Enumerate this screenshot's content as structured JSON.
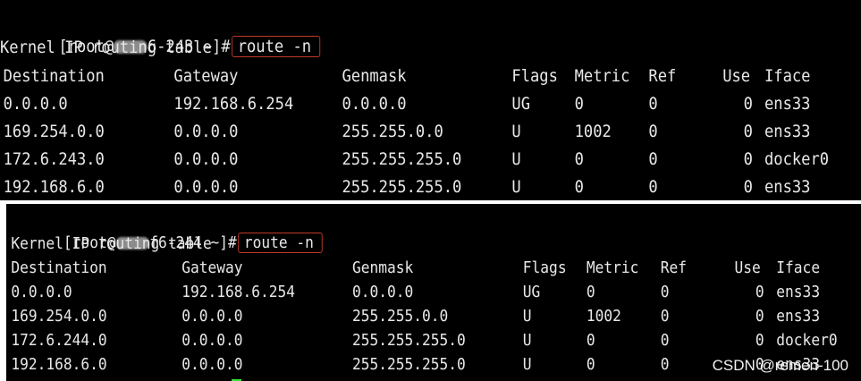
{
  "terminal_top": {
    "prompt_pre": "[root@",
    "prompt_host_visible": "6-243 ~]#",
    "command": "route -n",
    "title": "Kernel IP routing table",
    "headers": [
      "Destination",
      "Gateway",
      "Genmask",
      "Flags",
      "Metric",
      "Ref",
      "Use",
      "Iface"
    ],
    "rows": [
      [
        "0.0.0.0",
        "192.168.6.254",
        "0.0.0.0",
        "UG",
        "0",
        "0",
        "0",
        "ens33"
      ],
      [
        "169.254.0.0",
        "0.0.0.0",
        "255.255.0.0",
        "U",
        "1002",
        "0",
        "0",
        "ens33"
      ],
      [
        "172.6.243.0",
        "0.0.0.0",
        "255.255.255.0",
        "U",
        "0",
        "0",
        "0",
        "docker0"
      ],
      [
        "192.168.6.0",
        "0.0.0.0",
        "255.255.255.0",
        "U",
        "0",
        "0",
        "0",
        "ens33"
      ]
    ]
  },
  "terminal_bottom": {
    "prompt_pre": "[root@",
    "prompt_host_visible": "f6-244 ~]#",
    "command": "route -n",
    "title": "Kernel IP routing table",
    "headers": [
      "Destination",
      "Gateway",
      "Genmask",
      "Flags",
      "Metric",
      "Ref",
      "Use",
      "Iface"
    ],
    "rows": [
      [
        "0.0.0.0",
        "192.168.6.254",
        "0.0.0.0",
        "UG",
        "0",
        "0",
        "0",
        "ens33"
      ],
      [
        "169.254.0.0",
        "0.0.0.0",
        "255.255.0.0",
        "U",
        "1002",
        "0",
        "0",
        "ens33"
      ],
      [
        "172.6.244.0",
        "0.0.0.0",
        "255.255.255.0",
        "U",
        "0",
        "0",
        "0",
        "docker0"
      ],
      [
        "192.168.6.0",
        "0.0.0.0",
        "255.255.255.0",
        "U",
        "0",
        "0",
        "0",
        "ens33"
      ]
    ]
  },
  "watermark": "CSDN @remen-100",
  "colors": {
    "terminal_bg": "#000000",
    "text": "#e8e8e8",
    "command_box": "#c0392b",
    "cursor": "#35e035"
  }
}
